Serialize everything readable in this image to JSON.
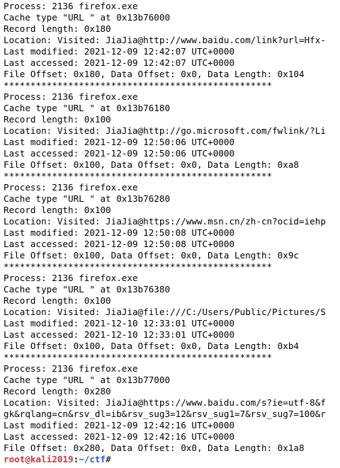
{
  "terminal": {
    "lines": [
      "Process: 2136 firefox.exe",
      "Cache type \"URL \" at 0x13b76000",
      "Record length: 0x180",
      "Location: Visited: JiaJia@http://www.baidu.com/link?url=Hfx-",
      "Last modified: 2021-12-09 12:42:07 UTC+0000",
      "Last accessed: 2021-12-09 12:42:07 UTC+0000",
      "File Offset: 0x180, Data Offset: 0x0, Data Length: 0x104",
      "**************************************************",
      "Process: 2136 firefox.exe",
      "Cache type \"URL \" at 0x13b76180",
      "Record length: 0x100",
      "Location: Visited: JiaJia@http://go.microsoft.com/fwlink/?Li",
      "Last modified: 2021-12-09 12:50:06 UTC+0000",
      "Last accessed: 2021-12-09 12:50:06 UTC+0000",
      "File Offset: 0x100, Data Offset: 0x0, Data Length: 0xa8",
      "**************************************************",
      "Process: 2136 firefox.exe",
      "Cache type \"URL \" at 0x13b76280",
      "Record length: 0x100",
      "Location: Visited: JiaJia@https://www.msn.cn/zh-cn?ocid=iehp",
      "Last modified: 2021-12-09 12:50:08 UTC+0000",
      "Last accessed: 2021-12-09 12:50:08 UTC+0000",
      "File Offset: 0x100, Data Offset: 0x0, Data Length: 0x9c",
      "**************************************************",
      "Process: 2136 firefox.exe",
      "Cache type \"URL \" at 0x13b76380",
      "Record length: 0x100",
      "Location: Visited: JiaJia@file:///C:/Users/Public/Pictures/S",
      "Last modified: 2021-12-10 12:33:01 UTC+0000",
      "Last accessed: 2021-12-10 12:33:01 UTC+0000",
      "File Offset: 0x100, Data Offset: 0x0, Data Length: 0xb4",
      "**************************************************",
      "Process: 2136 firefox.exe",
      "Cache type \"URL \" at 0x13b77000",
      "Record length: 0x280",
      "Location: Visited: JiaJia@https://www.baidu.com/s?ie=utf-8&f",
      "gk&rqlang=cn&rsv_dl=ib&rsv_sug3=12&rsv_sug1=7&rsv_sug7=100&r",
      "Last modified: 2021-12-09 12:42:16 UTC+0000",
      "Last accessed: 2021-12-09 12:42:16 UTC+0000",
      "File Offset: 0x280, Data Offset: 0x0, Data Length: 0x1a8"
    ],
    "prompt": {
      "user_host": "root@kali2019",
      "colon": ":",
      "path": "~/ctf",
      "symbol": "#"
    },
    "colors": {
      "background": "#ffffff",
      "text": "#000000",
      "prompt_user": "#d7303b",
      "prompt_path": "#2a5bd7"
    }
  }
}
